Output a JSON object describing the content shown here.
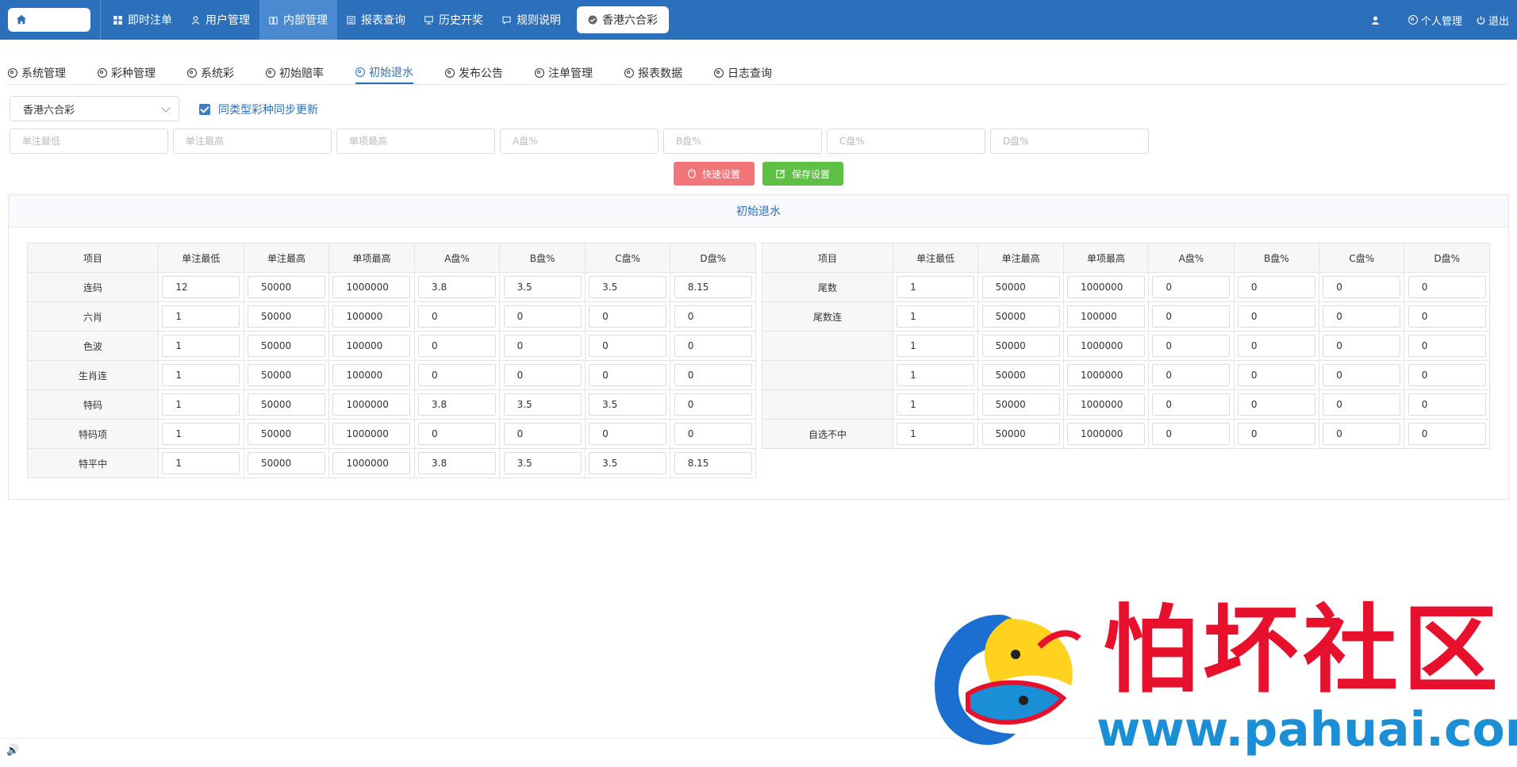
{
  "nav": {
    "items": [
      {
        "label": "即时注单",
        "icon": "grid-icon",
        "active": false
      },
      {
        "label": "用户管理",
        "icon": "user-icon",
        "active": false
      },
      {
        "label": "内部管理",
        "icon": "book-icon",
        "active": true
      },
      {
        "label": "报表查询",
        "icon": "report-icon",
        "active": false
      },
      {
        "label": "历史开奖",
        "icon": "monitor-icon",
        "active": false
      },
      {
        "label": "规则说明",
        "icon": "comment-icon",
        "active": false
      }
    ],
    "pill_label": "香港六合彩",
    "right": {
      "profile": "个人管理",
      "logout": "退出"
    }
  },
  "tabs": [
    {
      "label": "系统管理",
      "active": false
    },
    {
      "label": "彩种管理",
      "active": false
    },
    {
      "label": "系统彩",
      "active": false
    },
    {
      "label": "初始赔率",
      "active": false
    },
    {
      "label": "初始退水",
      "active": true
    },
    {
      "label": "发布公告",
      "active": false
    },
    {
      "label": "注单管理",
      "active": false
    },
    {
      "label": "报表数据",
      "active": false
    },
    {
      "label": "日志查询",
      "active": false
    }
  ],
  "controls": {
    "lottery_select": "香港六合彩",
    "sync_label": "同类型彩种同步更新",
    "quick_placeholders": [
      "单注最低",
      "单注最高",
      "单项最高",
      "A盘%",
      "B盘%",
      "C盘%",
      "D盘%"
    ],
    "quick_button": "快速设置",
    "save_button": "保存设置"
  },
  "panel": {
    "title": "初始退水",
    "headers": [
      "项目",
      "单注最低",
      "单注最高",
      "单项最高",
      "A盘%",
      "B盘%",
      "C盘%",
      "D盘%"
    ],
    "left_rows": [
      {
        "name": "连码",
        "values": [
          "12",
          "50000",
          "1000000",
          "3.8",
          "3.5",
          "3.5",
          "8.15"
        ]
      },
      {
        "name": "六肖",
        "values": [
          "1",
          "50000",
          "100000",
          "0",
          "0",
          "0",
          "0"
        ]
      },
      {
        "name": "色波",
        "values": [
          "1",
          "50000",
          "100000",
          "0",
          "0",
          "0",
          "0"
        ]
      },
      {
        "name": "生肖连",
        "values": [
          "1",
          "50000",
          "100000",
          "0",
          "0",
          "0",
          "0"
        ]
      },
      {
        "name": "特码",
        "values": [
          "1",
          "50000",
          "1000000",
          "3.8",
          "3.5",
          "3.5",
          "0"
        ]
      },
      {
        "name": "特码项",
        "values": [
          "1",
          "50000",
          "1000000",
          "0",
          "0",
          "0",
          "0"
        ]
      },
      {
        "name": "特平中",
        "values": [
          "1",
          "50000",
          "1000000",
          "3.8",
          "3.5",
          "3.5",
          "8.15"
        ]
      }
    ],
    "right_rows": [
      {
        "name": "尾数",
        "values": [
          "1",
          "50000",
          "1000000",
          "0",
          "0",
          "0",
          "0"
        ]
      },
      {
        "name": "尾数连",
        "values": [
          "1",
          "50000",
          "100000",
          "0",
          "0",
          "0",
          "0"
        ]
      },
      {
        "name": "",
        "values": [
          "1",
          "50000",
          "1000000",
          "0",
          "0",
          "0",
          "0"
        ]
      },
      {
        "name": "",
        "values": [
          "1",
          "50000",
          "1000000",
          "0",
          "0",
          "0",
          "0"
        ]
      },
      {
        "name": "",
        "values": [
          "1",
          "50000",
          "1000000",
          "0",
          "0",
          "0",
          "0"
        ]
      },
      {
        "name": "自选不中",
        "values": [
          "1",
          "50000",
          "1000000",
          "0",
          "0",
          "0",
          "0"
        ]
      }
    ]
  },
  "watermark": {
    "title": "怕坏社区",
    "url": "www.pahuai.com"
  },
  "colors": {
    "nav_bg": "#2c6fbb",
    "accent": "#2c6fbb",
    "quick_btn": "#f0767a",
    "save_btn": "#5ec045"
  }
}
